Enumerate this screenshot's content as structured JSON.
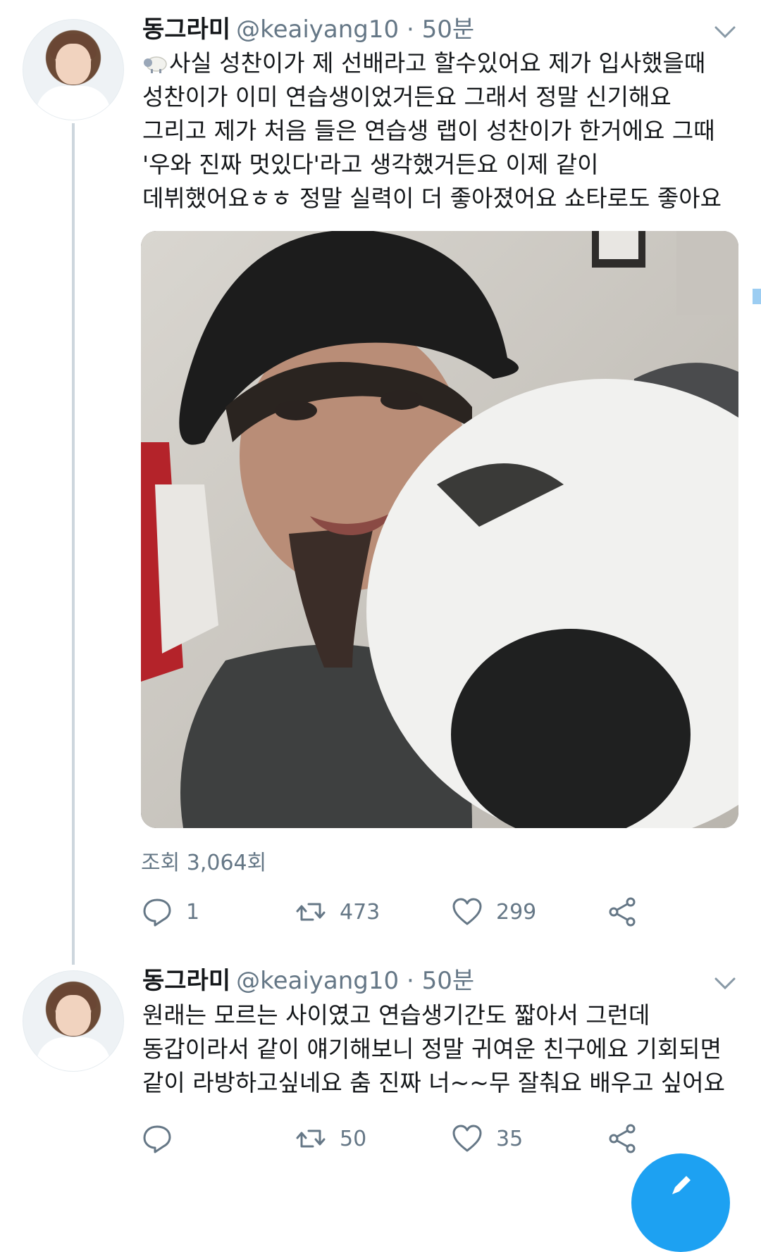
{
  "tweets": [
    {
      "display_name": "동그라미",
      "meta": "@keaiyang10 · 50분",
      "lines": [
        "사실 성찬이가 제 선배라고 할수있어요 제가 입사했을때",
        "성찬이가 이미 연습생이었거든요 그래서 정말 신기해요",
        "그리고 제가 처음 들은 연습생 랩이 성찬이가 한거에요 그때",
        "'우와 진짜 멋있다'라고 생각했거든요 이제 같이",
        "데뷔했어요ㅎㅎ 정말 실력이 더 좋아졌어요 쇼타로도 좋아요"
      ],
      "views": "조회 3,064회",
      "replies": "1",
      "retweets": "473",
      "likes": "299"
    },
    {
      "display_name": "동그라미",
      "meta": "@keaiyang10 · 50분",
      "lines": [
        "원래는 모르는 사이였고 연습생기간도 짧아서 그런데",
        "동갑이라서 같이 얘기해보니 정말 귀여운 친구에요 기회되면",
        "같이 라방하고싶네요 춤 진짜 너~~무 잘춰요 배우고 싶어요"
      ],
      "replies": "",
      "retweets": "50",
      "likes": "35"
    }
  ],
  "icons": [
    "chevron-down-icon",
    "sheep-emoji-icon",
    "reply-icon",
    "retweet-icon",
    "like-icon",
    "share-icon",
    "compose-icon"
  ],
  "colors": {
    "accent": "#1da1f2",
    "secondary_text": "#657786",
    "thread_line": "#cdd6dd"
  }
}
